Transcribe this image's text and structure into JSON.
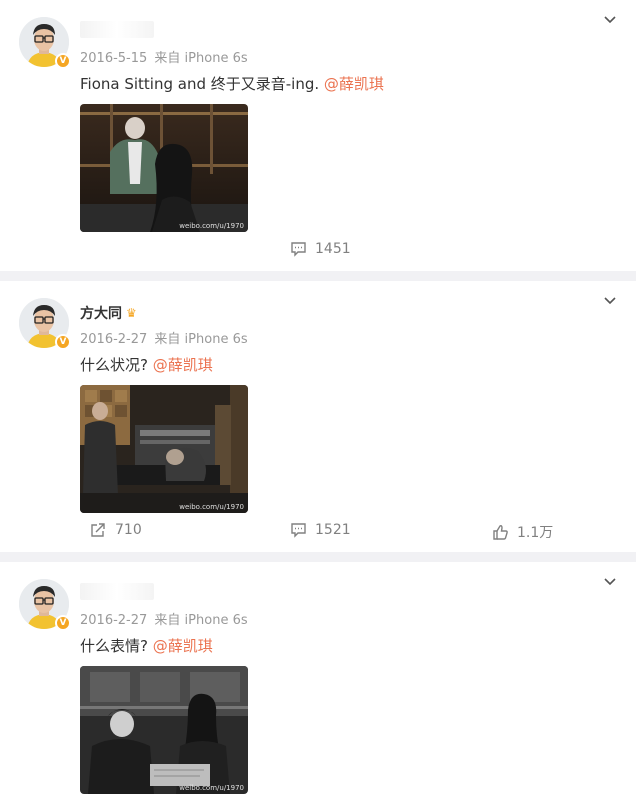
{
  "posts": [
    {
      "name": "",
      "date": "2016-5-15",
      "source": "来自 iPhone 6s",
      "text": "Fiona Sitting and 终于又录音-ing. ",
      "mention": "@薛凯琪",
      "watermark": "weibo.com/u/1970",
      "repost_count": "",
      "comment_count": "1451",
      "like_count": ""
    },
    {
      "name": "方大同",
      "date": "2016-2-27",
      "source": "来自 iPhone 6s",
      "text": "什么状况? ",
      "mention": "@薛凯琪",
      "watermark": "weibo.com/u/1970",
      "repost_count": "710",
      "comment_count": "1521",
      "like_count": "1.1万"
    },
    {
      "name": "",
      "date": "2016-2-27",
      "source": "来自 iPhone 6s",
      "text": "什么表情? ",
      "mention": "@薛凯琪",
      "watermark": "weibo.com/u/1970"
    }
  ],
  "icons": {
    "more": "chevron-down-icon",
    "repost": "share-icon",
    "comment": "comment-icon",
    "like": "thumbs-up-icon",
    "verified": "verified-badge-icon",
    "crown": "crown-icon"
  },
  "colors": {
    "mention": "#eb7350",
    "meta": "#999999",
    "badge": "#f5a623",
    "background": "#f1f1f4"
  }
}
